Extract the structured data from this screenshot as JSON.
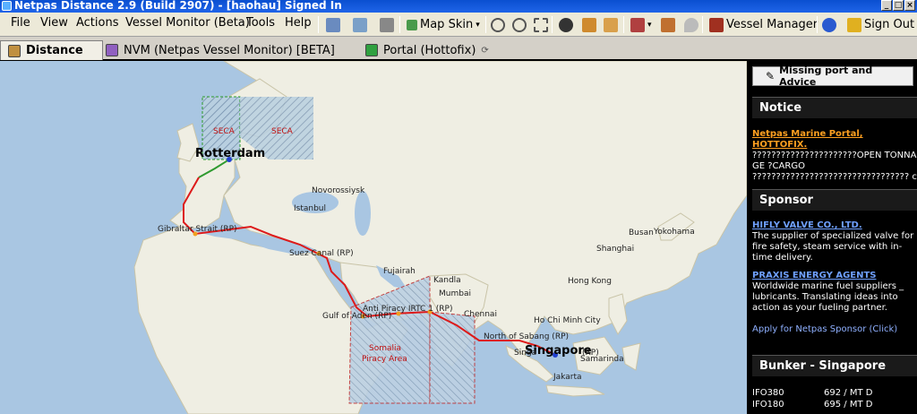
{
  "window": {
    "title": "Netpas Distance 2.9 (Build 2907) - [haohau] Signed In"
  },
  "menu": {
    "items": [
      "File",
      "View",
      "Actions",
      "Vessel Monitor (Beta)",
      "Tools",
      "Help"
    ]
  },
  "toolbar": {
    "map_skin": "Map Skin",
    "vessel_manager": "Vessel Manager",
    "sign_out": "Sign Out"
  },
  "tabs": [
    "Distance",
    "NVM (Netpas Vessel Monitor) [BETA]",
    "Portal (Hottofix)"
  ],
  "map": {
    "labels": {
      "rotterdam": "Rotterdam",
      "seca1": "SECA",
      "seca2": "SECA",
      "novorossiysk": "Novorossiysk",
      "istanbul": "Istanbul",
      "gibraltar": "Gibraltar Strait (RP)",
      "suez": "Suez Canal (RP)",
      "fujairah": "Fujairah",
      "kandla": "Kandla",
      "mumbai": "Mumbai",
      "antipiracy": "Anti Piracy IRTC 1 (RP)",
      "antipiracy2": "IRTC 1 (RP)",
      "gulfaden": "Gulf of Aden (RP)",
      "chennai": "Chennai",
      "somalia": "Somalia",
      "piracy": "Piracy Area",
      "sabang": "North of Sabang (RP)",
      "singapore": "Singapore",
      "singapore_strait": "Singa",
      "rp_sg": "(RP)",
      "samarinda": "Samarinda",
      "jakarta": "Jakarta",
      "hcmc": "Ho Chi Minh City",
      "hongkong": "Hong Kong",
      "shanghai": "Shanghai",
      "busan": "Busan",
      "yokohama": "Yokohama"
    }
  },
  "sidebar": {
    "missing_port": "Missing port and Advice",
    "notice": {
      "title": "Notice",
      "link": "Netpas Marine Portal, HOTTOFIX.",
      "text": "??????????????????????OPEN TONNAGE ?CARGO ????????????????????????????????? cargo, tonnage"
    },
    "sponsor": {
      "title": "Sponsor",
      "items": [
        {
          "name": "HIFLY VALVE CO., LTD.",
          "desc": "The supplier of specialized valve for fire safety, steam service with in-time delivery."
        },
        {
          "name": "PRAXIS ENERGY AGENTS",
          "desc": "Worldwide marine fuel suppliers _ lubricants. Translating ideas into action as your fueling partner."
        }
      ],
      "apply": "Apply for Netpas Sponsor (Click)"
    },
    "bunker": {
      "title": "Bunker - Singapore",
      "rows": [
        {
          "grade": "IFO380",
          "price": "692 / MT D"
        },
        {
          "grade": "IFO180",
          "price": "695 / MT D"
        }
      ]
    }
  },
  "colors": {
    "route": "#dd1a1a",
    "route_green": "#2f9a2f",
    "sea": "#a9c6e2",
    "land": "#efeee3"
  }
}
